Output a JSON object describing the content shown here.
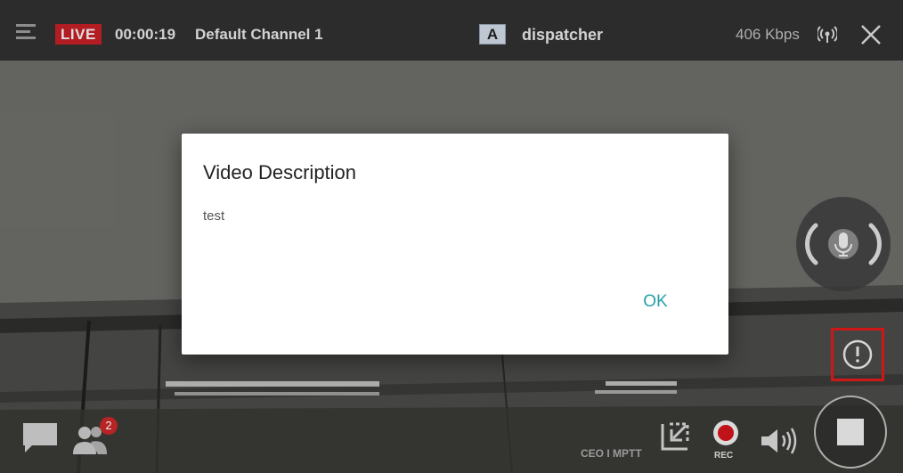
{
  "top_bar": {
    "live_label": "LIVE",
    "timer": "00:00:19",
    "channel_name": "Default Channel 1",
    "group_letter": "A",
    "dispatcher_label": "dispatcher",
    "bitrate": "406 Kbps"
  },
  "icons": {
    "menu": "menu-icon",
    "signal": "signal-icon",
    "close": "close-icon",
    "mic": "microphone-icon",
    "info": "exclamation-icon",
    "stop": "stop-icon",
    "chat": "chat-icon",
    "users": "users-icon",
    "minimize": "minimize-icon",
    "record": "record-icon",
    "speaker": "speaker-icon"
  },
  "bottom_bar": {
    "users_count": "2",
    "overlay_text": "CEO I MPTT",
    "rec_label": "REC"
  },
  "dialog": {
    "title": "Video Description",
    "body": "test",
    "ok_label": "OK"
  },
  "colors": {
    "live_red": "#c21f26",
    "ok_teal": "#26a0a8",
    "highlight_red": "#e01b1b"
  }
}
